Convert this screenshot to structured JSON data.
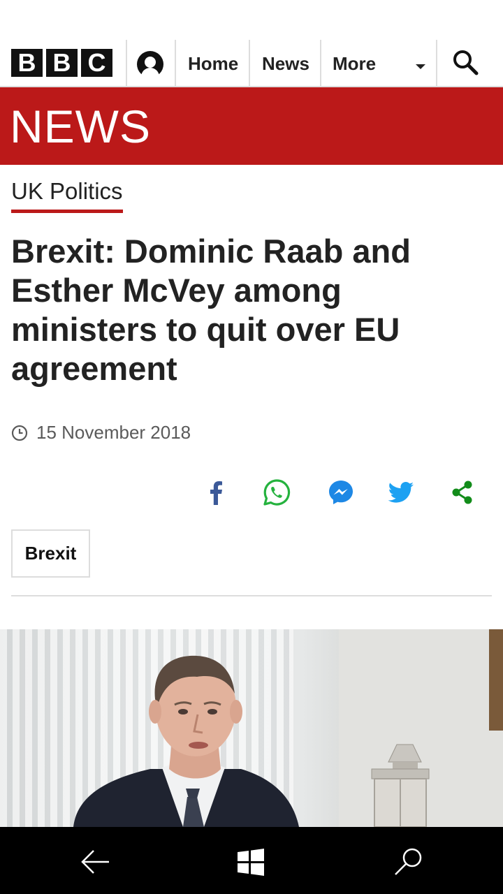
{
  "nav": {
    "logo_letters": [
      "B",
      "B",
      "C"
    ],
    "account_icon": "account-icon",
    "links": [
      "Home",
      "News",
      "More"
    ],
    "search_icon": "search-icon"
  },
  "banner": {
    "title": "NEWS",
    "color": "#bb1919"
  },
  "article": {
    "section": "UK Politics",
    "headline": "Brexit: Dominic Raab and Esther McVey among ministers to quit over EU agreement",
    "date": "15 November 2018",
    "tag": "Brexit"
  },
  "share": [
    {
      "icon": "facebook-icon",
      "color": "#3b5998"
    },
    {
      "icon": "whatsapp-icon",
      "color": "#25b23e"
    },
    {
      "icon": "messenger-icon",
      "color": "#1e88e5"
    },
    {
      "icon": "twitter-icon",
      "color": "#1da1f2"
    },
    {
      "icon": "share-icon",
      "color": "#128c1a"
    }
  ],
  "system_bar": {
    "icons": [
      "back-arrow-icon",
      "windows-icon",
      "search-icon"
    ]
  }
}
